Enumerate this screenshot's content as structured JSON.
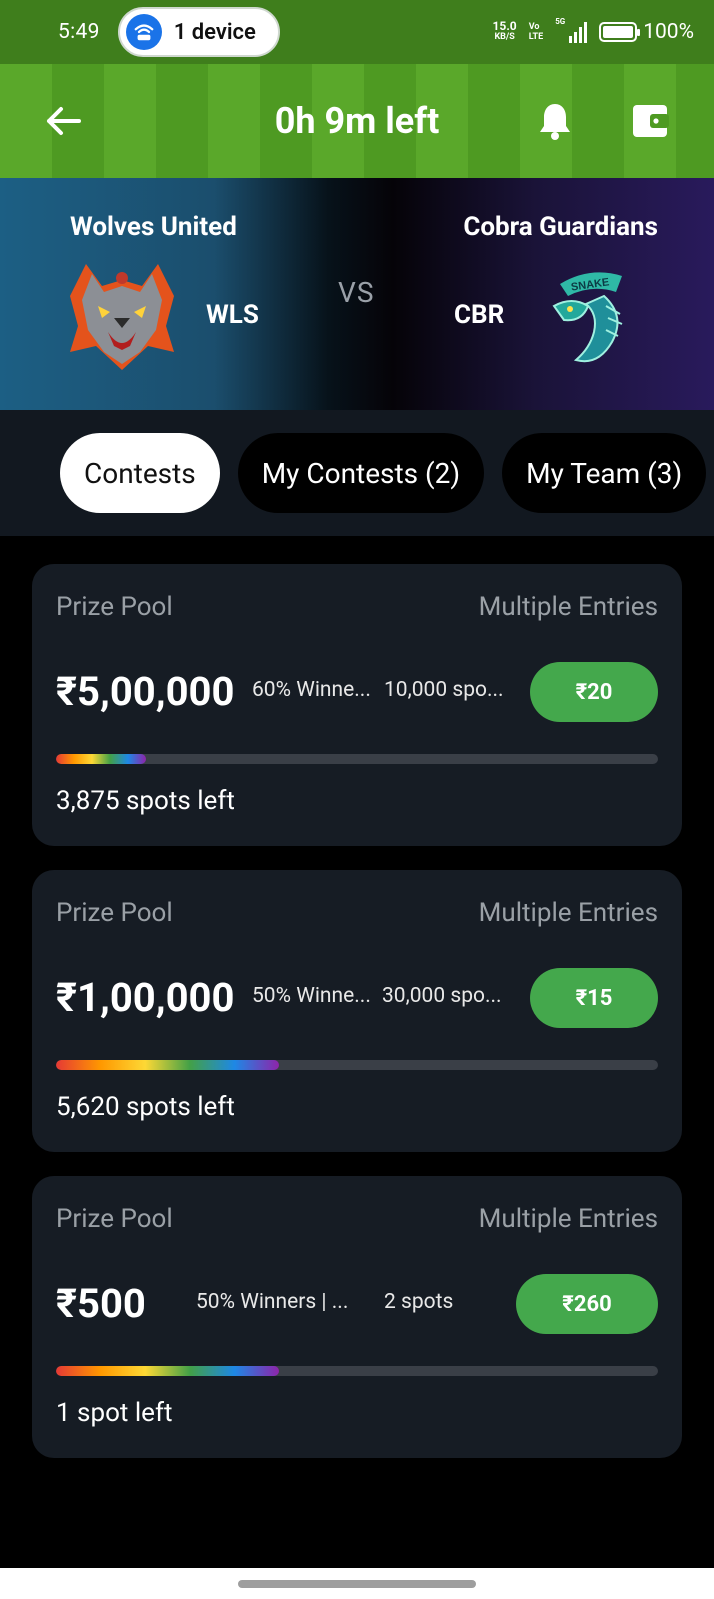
{
  "status_bar": {
    "time": "5:49",
    "hotspot_label": "1 device",
    "net_speed": "15.0",
    "net_speed_unit": "KB/S",
    "volte_top": "Vo",
    "volte_bottom": "LTE",
    "network_type": "5G",
    "battery": "100%"
  },
  "header": {
    "title": "0h 9m left"
  },
  "match": {
    "team1": {
      "name": "Wolves United",
      "code": "WLS"
    },
    "team2": {
      "name": "Cobra Guardians",
      "code": "CBR"
    },
    "vs": "VS",
    "snake_badge": "SNAKE"
  },
  "tabs": [
    {
      "label": "Contests",
      "active": true
    },
    {
      "label": "My Contests (2)",
      "active": false
    },
    {
      "label": "My Team (3)",
      "active": false
    }
  ],
  "contests": [
    {
      "label": "Prize Pool",
      "entry_type": "Multiple Entries",
      "prize": "₹5,00,000",
      "winners": "60% Winne...",
      "spots": "10,000 spo...",
      "fee": "₹20",
      "progress": 0.15,
      "spots_left": "3,875 spots left"
    },
    {
      "label": "Prize Pool",
      "entry_type": "Multiple Entries",
      "prize": "₹1,00,000",
      "winners": "50% Winne...",
      "spots": "30,000 spo...",
      "fee": "₹15",
      "progress": 0.37,
      "spots_left": "5,620 spots left"
    },
    {
      "label": "Prize Pool",
      "entry_type": "Multiple Entries",
      "prize": "₹500",
      "winners": "50% Winners | ...",
      "spots": "2 spots",
      "fee": "₹260",
      "progress": 0.37,
      "spots_left": "1 spot left"
    }
  ],
  "colors": {
    "header_green": "#5aa82a",
    "fee_button": "#44a84c",
    "card_bg": "#161c24",
    "tabs_bg": "#121820"
  }
}
